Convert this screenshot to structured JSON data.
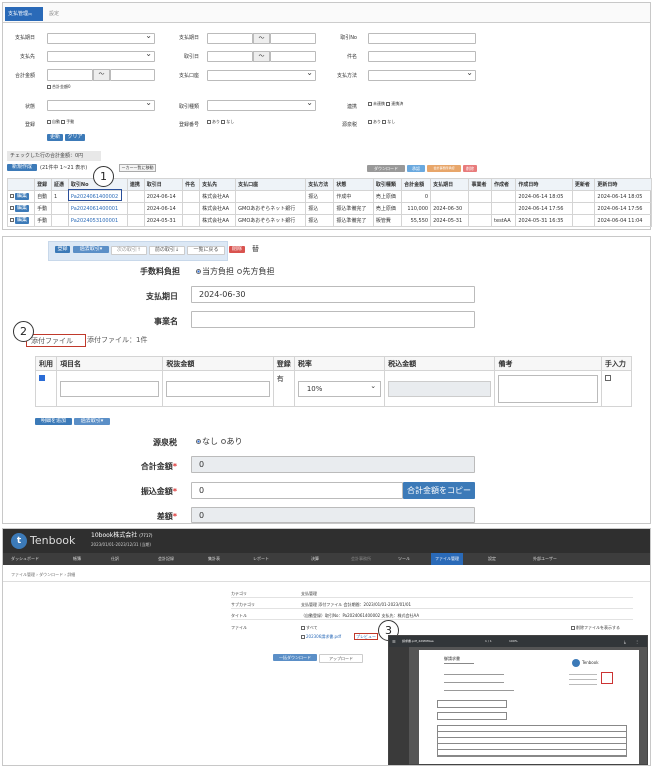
{
  "callouts": [
    "1",
    "2",
    "3"
  ],
  "p1": {
    "tabs": [
      "支払管理",
      "設定"
    ],
    "tab_badge": "(0)",
    "filters": {
      "l1": [
        "支払期日",
        "支払先",
        "合計金額",
        "状態",
        "登録"
      ],
      "l2": [
        "支払期日",
        "取引日",
        "支払口座",
        "取引種類",
        "登録番号"
      ],
      "l3": [
        "取引No",
        "件名",
        "支払方法",
        "連携",
        "源泉税"
      ],
      "tilde": "〜",
      "zero_label": "合計金額0",
      "jidou": "自動",
      "shudou": "手動",
      "ari": "あり",
      "nashi": "なし",
      "mirenkei": "未連携",
      "renkeizumi": "連携済"
    },
    "search_btn": "更新",
    "clear_btn": "クリア",
    "checked_total": "チェックした行の合計金額：0円",
    "new_btn": "新規作成",
    "range_text": "(21件中 1~21 表示)",
    "move_btn": "ーカー一覧に移動",
    "right_btns": [
      "ダウンロード",
      "承認",
      "会計事務所承認",
      "削除"
    ],
    "headers": [
      "",
      "登録",
      "証憑",
      "取引No",
      "連携",
      "取引日",
      "件名",
      "支払先",
      "支払口座",
      "支払方法",
      "状態",
      "取引種類",
      "合計金額",
      "支払期日",
      "事業者",
      "作成者",
      "作成日時",
      "更新者",
      "更新日時"
    ],
    "rows": [
      {
        "edit": "編集",
        "reg": "自動",
        "att": "1",
        "no": "Pa2024061400002",
        "date": "2024-06-14",
        "subj": "",
        "payee": "株式会社AA",
        "acct": "",
        "meth": "振込",
        "status": "作成中",
        "kind": "売上原価",
        "amt": "0",
        "due": "",
        "biz": "",
        "creator": "",
        "created": "2024-06-14 18:05",
        "upd": "",
        "updated": "2024-06-14 18:05"
      },
      {
        "edit": "編集",
        "reg": "手動",
        "att": "",
        "no": "Pa2024061400001",
        "date": "2024-06-14",
        "subj": "",
        "payee": "株式会社AA",
        "acct": "GMOあおぞらネット銀行",
        "meth": "振込",
        "status": "振込準備完了",
        "kind": "売上原価",
        "amt": "110,000",
        "due": "2024-06-30",
        "biz": "",
        "creator": "",
        "created": "2024-06-14 17:56",
        "upd": "",
        "updated": "2024-06-14 17:56"
      },
      {
        "edit": "編集",
        "reg": "手動",
        "att": "",
        "no": "Pa2024053100001",
        "date": "2024-05-31",
        "subj": "",
        "payee": "株式会社AA",
        "acct": "GMOあおぞらネット銀行",
        "meth": "振込",
        "status": "振込準備完了",
        "kind": "販管費",
        "amt": "55,550",
        "due": "2024-05-31",
        "biz": "",
        "creator": "testAA",
        "created": "2024-05-31 16:35",
        "upd": "",
        "updated": "2024-06-04 11:04"
      }
    ]
  },
  "p2": {
    "top_btns": [
      "登録",
      "過去取引▾",
      "次の取引↑",
      "前の取引↓",
      "一覧に戻る",
      "削除"
    ],
    "extra": "替",
    "fee_label": "手数料負担",
    "fee_opt1": "当方負担",
    "fee_opt2": "先方負担",
    "due_label": "支払期日",
    "due_value": "2024-06-30",
    "biz_label": "事業名",
    "att_tab": "添付ファイル",
    "att_text": "添付ファイル：1件",
    "cols": [
      "利用",
      "項目名",
      "税抜金額",
      "登録",
      "税率",
      "税込金額",
      "備考",
      "手入力"
    ],
    "row_reg": "有",
    "tax_rate": "10%",
    "add_btn": "明細を追加",
    "past_btn": "過去取引▾",
    "gensen_label": "源泉税",
    "gensen_opt1": "なし",
    "gensen_opt2": "あり",
    "total_label": "合計金額",
    "total_value": "0",
    "transfer_label": "振込金額",
    "transfer_value": "0",
    "copy_btn": "合計金額をコピー",
    "diff_label": "差額",
    "diff_value": "0",
    "req": "*"
  },
  "p3": {
    "logo": "Tenbook",
    "company": "10book株式会社",
    "company_code": "(7717)",
    "period": "2023/01/01-2023/12/31 (当期)",
    "nav": [
      "ダッシュボード",
      "帳簿",
      "仕訳",
      "会計記録",
      "集計表",
      "レポート",
      "決算",
      "会計事務所",
      "ツール",
      "ファイル管理",
      "設定",
      "外部ユーザー"
    ],
    "breadcrumb": [
      "ファイル管理",
      "ダウンロード",
      "詳細"
    ],
    "rows": [
      {
        "k": "カテゴリ",
        "v": "支払管理"
      },
      {
        "k": "サブカテゴリ",
        "v": "支払管理 添付ファイル 会計期間：2023/01/01-2023/01/01"
      },
      {
        "k": "タイトル",
        "v": "（自動登録）取引No：Pa2024061400002 支払先：株式会社AA"
      }
    ],
    "file_label": "ファイル",
    "all_label": "すべて",
    "file_name": "202306請求書.pdf",
    "preview": "プレビュー",
    "show_deleted": "削除ファイルを表示する",
    "dl_btn": "一括ダウンロード",
    "upload_btn": "アップロード",
    "pdf": {
      "name": "請求書.pdf_4d9f0f9aa",
      "page": "1",
      "pages": "1",
      "zoom": "100%",
      "doc_title": "御請求書",
      "brand": "Tenbook"
    }
  }
}
